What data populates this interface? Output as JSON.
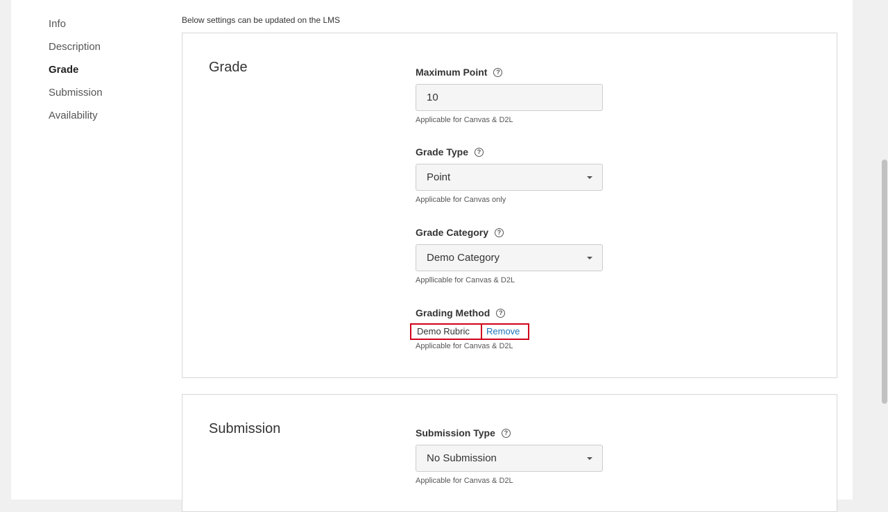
{
  "nav": {
    "items": [
      {
        "label": "Info"
      },
      {
        "label": "Description"
      },
      {
        "label": "Grade"
      },
      {
        "label": "Submission"
      },
      {
        "label": "Availability"
      }
    ]
  },
  "lms_note": "Below settings can be updated on the LMS",
  "grade": {
    "title": "Grade",
    "max_point": {
      "label": "Maximum Point",
      "value": "10",
      "hint": "Applicable for Canvas & D2L"
    },
    "grade_type": {
      "label": "Grade Type",
      "value": "Point",
      "hint": "Applicable for Canvas only"
    },
    "grade_category": {
      "label": "Grade Category",
      "value": "Demo Category",
      "hint": "Appllicable for Canvas & D2L"
    },
    "grading_method": {
      "label": "Grading Method",
      "rubric": "Demo Rubric",
      "remove": "Remove",
      "hint": "Applicable for Canvas & D2L"
    }
  },
  "submission": {
    "title": "Submission",
    "submission_type": {
      "label": "Submission Type",
      "value": "No Submission",
      "hint": "Applicable for Canvas & D2L"
    }
  },
  "icons": {
    "help": "question-circle-icon",
    "caret": "caret-down-icon"
  },
  "colors": {
    "highlight": "#d0021b",
    "link": "#1a73b8"
  }
}
